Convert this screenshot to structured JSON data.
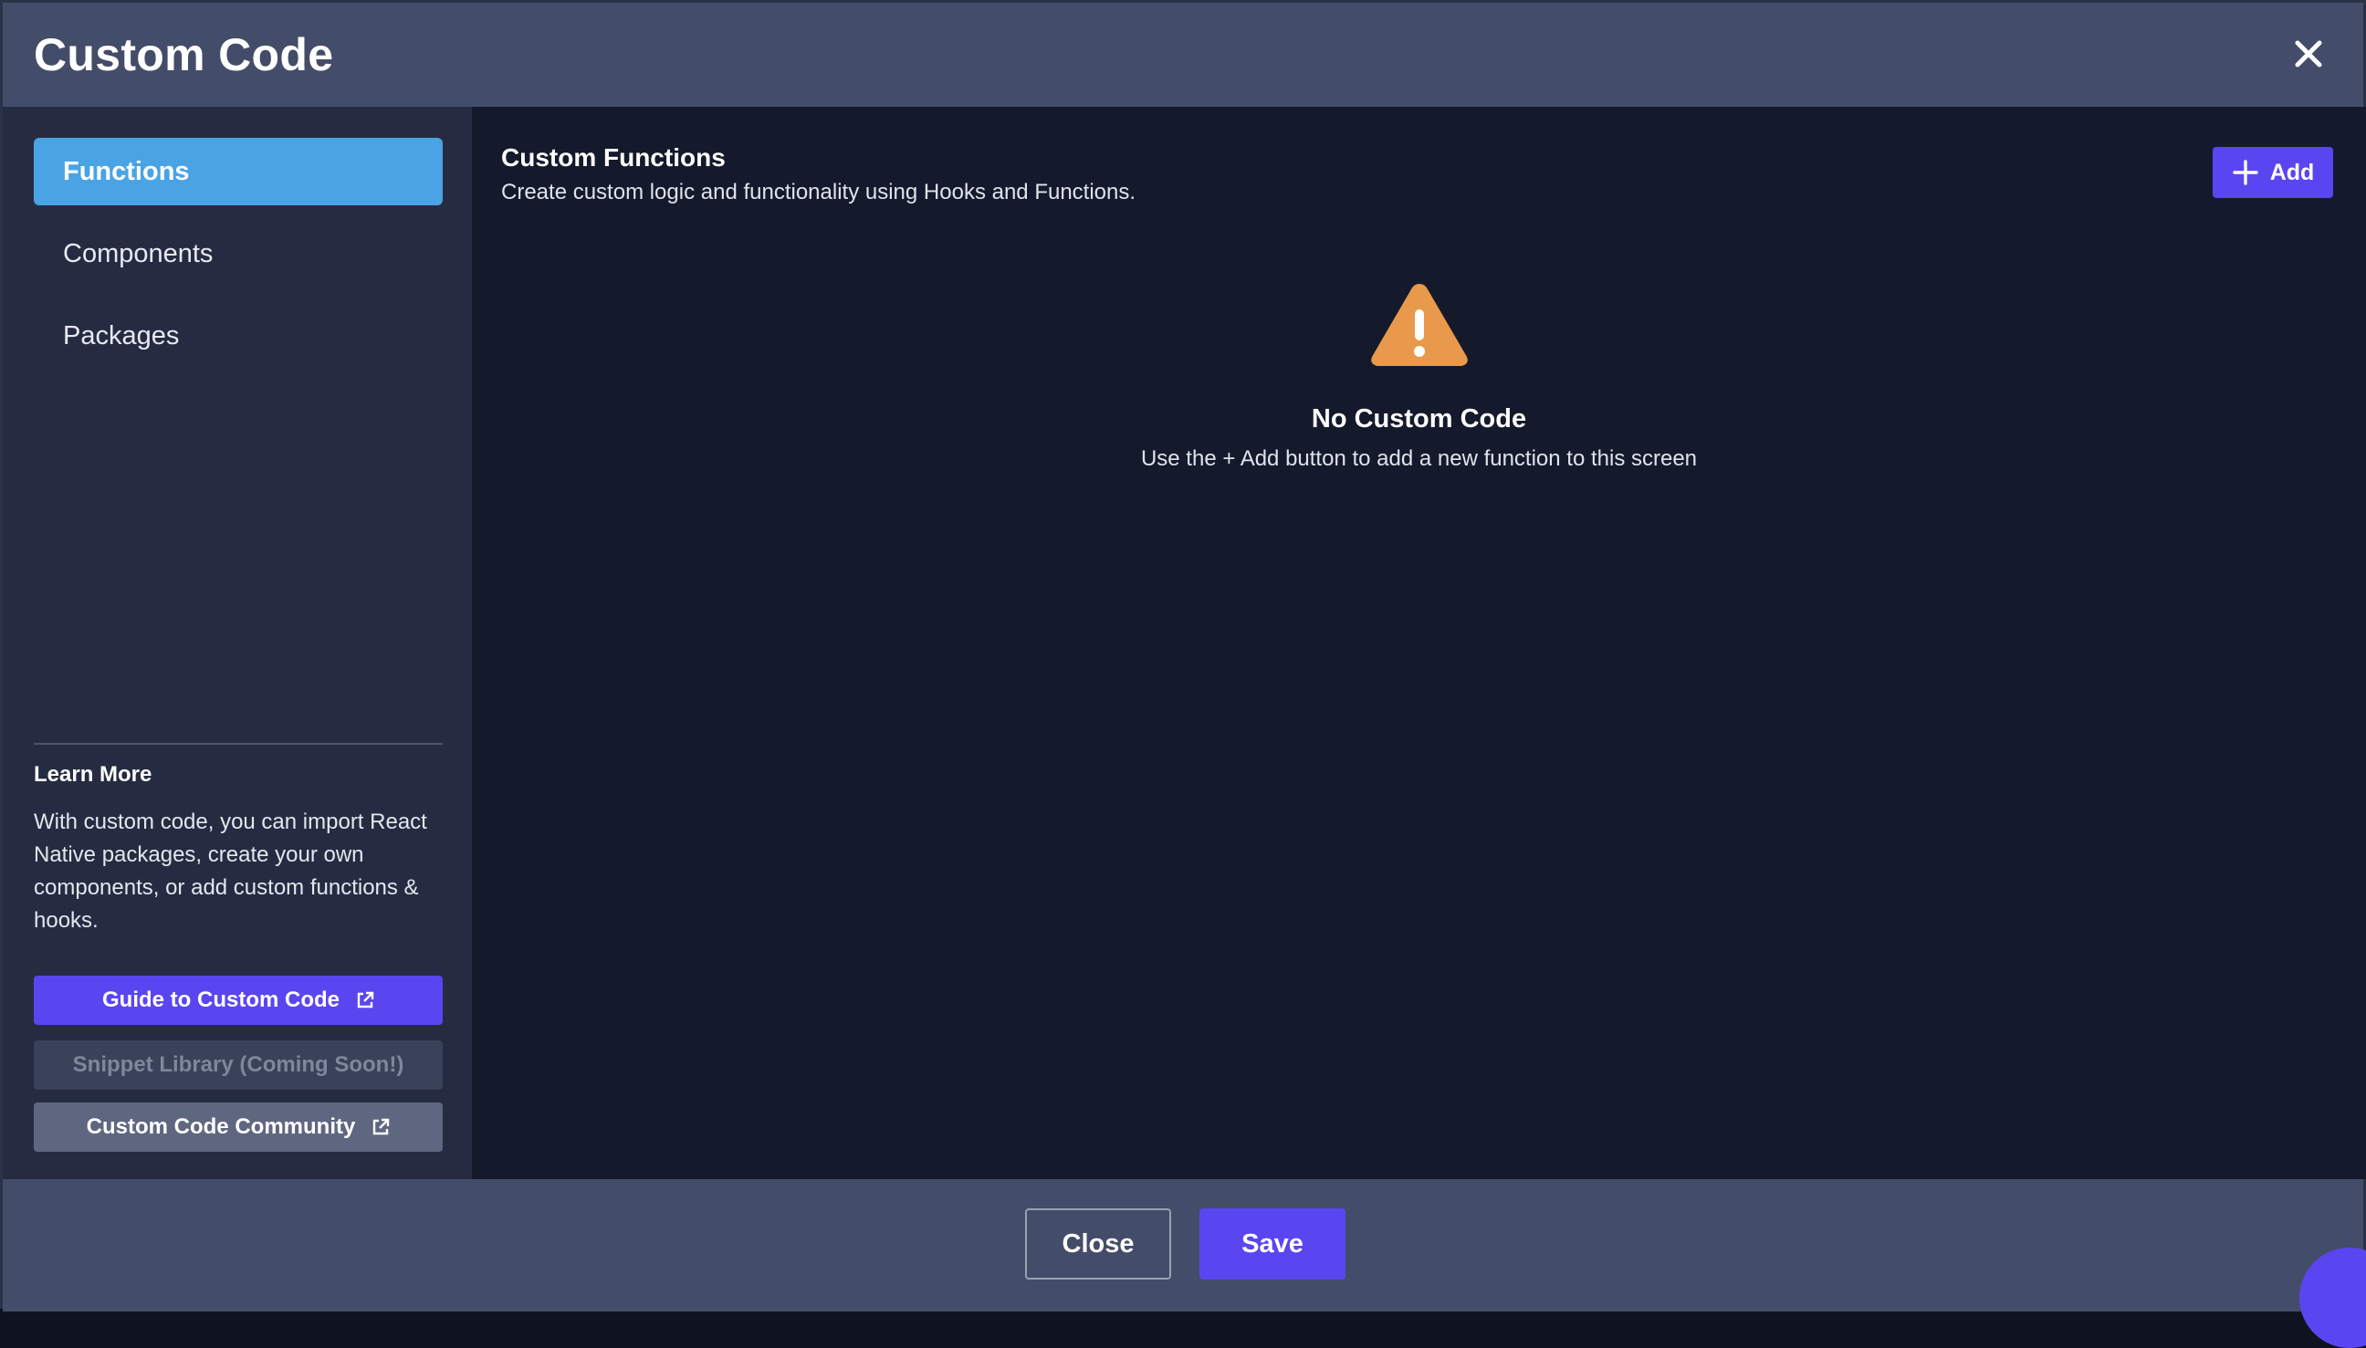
{
  "header": {
    "title": "Custom Code"
  },
  "sidebar": {
    "items": [
      {
        "label": "Functions",
        "active": true
      },
      {
        "label": "Components",
        "active": false
      },
      {
        "label": "Packages",
        "active": false
      }
    ],
    "learn_more": {
      "title": "Learn More",
      "text": "With custom code, you can import React Native packages, create your own components, or add custom functions & hooks."
    },
    "buttons": {
      "guide": "Guide to Custom Code",
      "snippet": "Snippet Library (Coming Soon!)",
      "community": "Custom Code Community"
    }
  },
  "main": {
    "title": "Custom Functions",
    "subtitle": "Create custom logic and functionality using Hooks and Functions.",
    "add_label": "Add",
    "empty_title": "No Custom Code",
    "empty_subtitle": "Use the + Add button to add a new function to this screen"
  },
  "footer": {
    "close_label": "Close",
    "save_label": "Save"
  },
  "colors": {
    "accent": "#5a46f0",
    "active_nav": "#4aa3e3",
    "warning": "#e9994b",
    "header_bg": "#434d69",
    "sidebar_bg": "#252c42",
    "main_bg": "#141a2b"
  },
  "icons": {
    "close": "close-icon",
    "add": "plus-icon",
    "external": "external-link-icon",
    "warning": "warning-triangle-icon"
  }
}
